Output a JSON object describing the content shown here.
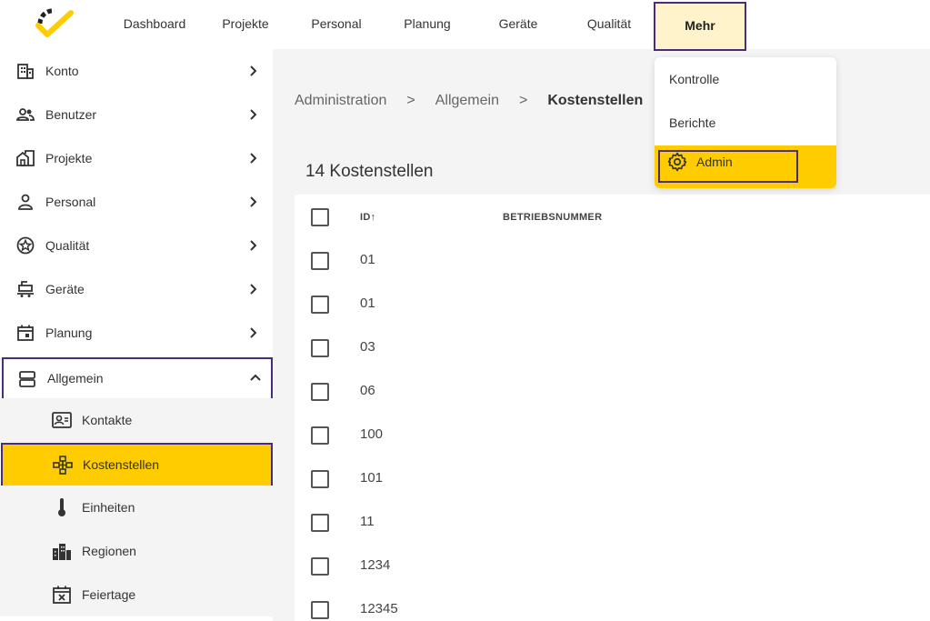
{
  "nav": {
    "items": [
      "Dashboard",
      "Projekte",
      "Personal",
      "Planung",
      "Geräte",
      "Qualität",
      "Mehr"
    ],
    "active": "Mehr"
  },
  "dropdown": {
    "items": [
      "Kontrolle",
      "Berichte"
    ],
    "active_label": "Admin",
    "active_icon": "gear-icon"
  },
  "sidebar": {
    "items": [
      {
        "label": "Konto",
        "icon": "building-icon"
      },
      {
        "label": "Benutzer",
        "icon": "users-icon"
      },
      {
        "label": "Projekte",
        "icon": "house-icon"
      },
      {
        "label": "Personal",
        "icon": "person-icon"
      },
      {
        "label": "Qualität",
        "icon": "star-badge-icon"
      },
      {
        "label": "Geräte",
        "icon": "machine-icon"
      },
      {
        "label": "Planung",
        "icon": "calendar-icon"
      },
      {
        "label": "Allgemein",
        "icon": "server-icon"
      }
    ],
    "subitems": [
      {
        "label": "Kontakte",
        "icon": "contact-card-icon"
      },
      {
        "label": "Kostenstellen",
        "icon": "hierarchy-icon"
      },
      {
        "label": "Einheiten",
        "icon": "thermometer-icon"
      },
      {
        "label": "Regionen",
        "icon": "city-icon"
      },
      {
        "label": "Feiertage",
        "icon": "calendar-x-icon"
      }
    ]
  },
  "breadcrumb": {
    "items": [
      "Administration",
      "Allgemein"
    ],
    "current": "Kostenstellen",
    "separator": ">"
  },
  "content": {
    "count_title": "14 Kostenstellen"
  },
  "table": {
    "columns": [
      "ID↑",
      "BETRIEBSNUMMER"
    ],
    "rows": [
      "01",
      "01",
      "03",
      "06",
      "100",
      "101",
      "11",
      "1234",
      "12345"
    ]
  },
  "colors": {
    "accent_yellow": "#ffcc00",
    "outline_purple": "#4a2d7a",
    "hover_yellow": "#fff3cc"
  }
}
